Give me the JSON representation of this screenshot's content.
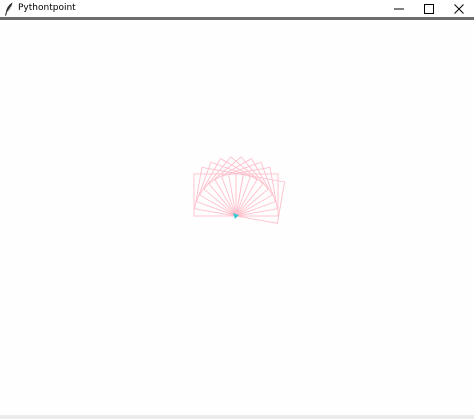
{
  "window": {
    "title": "Pythontpoint",
    "icons": {
      "app": "feather-icon",
      "minimize": "minimize-icon",
      "maximize": "maximize-icon",
      "close": "close-icon"
    }
  },
  "canvas": {
    "background": "#fefefe",
    "stroke_color": "#ffc0cb",
    "turtle_color": "#3cc8d2",
    "square_count": 11,
    "rotation_step_deg": 10
  }
}
